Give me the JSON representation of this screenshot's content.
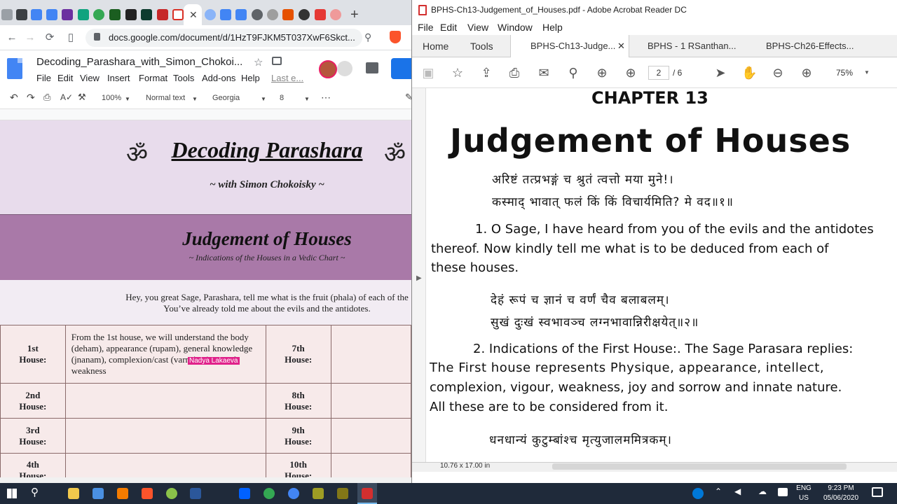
{
  "chrome": {
    "new_tab": "+",
    "url": "docs.google.com/document/d/1HzT9FJKM5T037XwF6Skct...",
    "doc_title": "Decoding_Parashara_with_Simon_Chokoi...",
    "menu": [
      "File",
      "Edit",
      "View",
      "Insert",
      "Format",
      "Tools",
      "Add-ons",
      "Help",
      "Last e..."
    ],
    "toolbar": {
      "zoom": "100%",
      "style": "Normal text",
      "font": "Georgia",
      "size": "8",
      "more": "⋯"
    }
  },
  "document": {
    "om": "ॐ",
    "heading": "Decoding Parashara",
    "subheading": "~ with Simon Chokoisky ~",
    "section_title": "Judgement of Houses",
    "section_sub": "~ Indications of the Houses in a Vedic Chart ~",
    "intro_line1": "Hey, you great Sage, Parashara, tell me what is the fruit (phala) of each of the",
    "intro_line2": "You’ve already told me about the evils and the antidotes.",
    "rows": [
      {
        "left_a": "1st",
        "left_b": "House:",
        "text": "From the 1st house, we will understand the body (deham), appearance (rupam), general knowledge (jnanam), complexion/cast (varna), vigor and weakness",
        "right_a": "7th",
        "right_b": "House:"
      },
      {
        "left_a": "2nd",
        "left_b": "House:",
        "text": "",
        "right_a": "8th",
        "right_b": "House:"
      },
      {
        "left_a": "3rd",
        "left_b": "House:",
        "text": "",
        "right_a": "9th",
        "right_b": "House:"
      },
      {
        "left_a": "4th",
        "left_b": "House:",
        "text": "",
        "right_a": "10th",
        "right_b": "House:"
      }
    ],
    "collaborator": "Nadya Lakaeva"
  },
  "acrobat": {
    "title": "BPHS-Ch13-Judgement_of_Houses.pdf - Adobe Acrobat Reader DC",
    "menu": [
      "File",
      "Edit",
      "View",
      "Window",
      "Help"
    ],
    "tabs": {
      "home": "Home",
      "tools": "Tools",
      "doc1": "BPHS-Ch13-Judge...",
      "doc2": "BPHS - 1 RSanthan...",
      "doc3": "BPHS-Ch26-Effects..."
    },
    "page_current": "2",
    "page_total": "/ 6",
    "zoom": "75%",
    "page_size": "10.76 x 17.00 in",
    "pdf": {
      "chapter": "CHAPTER 13",
      "title": "Judgement of Houses",
      "skt1a": "अरिष्टं  तत्प्रभङ्गं  च  श्रुतं  त्वत्तो  मया  मुने!।",
      "skt1b": "कस्माद् भावात्  फलं किं  किं  विचार्यमिति? मे वद॥१॥",
      "p1a": "1. O Sage, I have heard from you of the evils and the antidotes",
      "p1b": "thereof.  Now kindly tell me what is to be deduced from each of",
      "p1c": "these houses.",
      "skt2a": "देहं   रूपं   च   ज्ञानं   च   वर्णं   चैव   बलाबलम्।",
      "skt2b": "सुखं   दुःखं   स्वभावञ्च   लग्नभावान्निरीक्षयेत्॥२॥",
      "p2a": "2. Indications of the First House:. The Sage Parasara replies:",
      "p2b": "The First house represents Physique, appearance, intellect,",
      "p2c": "complexion, vigour, weakness, joy and sorrow and innate nature.",
      "p2d": "All these are to be considered from it.",
      "skt3a": "धनधान्यं          कुटुम्बांश्च          मृत्युजालममित्रकम्।"
    }
  },
  "taskbar": {
    "lang_a": "ENG",
    "lang_b": "US",
    "time": "9:23 PM",
    "date": "05/06/2020",
    "colors": {
      "bg": "#1f2a3a",
      "accent": "#0078d7"
    }
  }
}
